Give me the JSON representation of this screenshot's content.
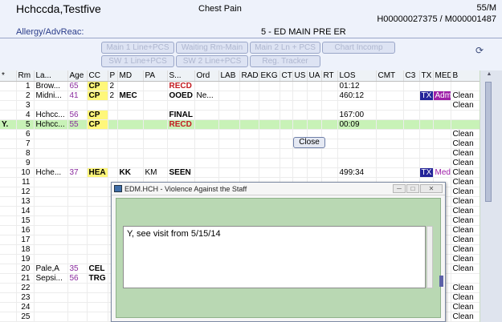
{
  "header": {
    "patient_name": "Hchccda,Testfive",
    "chief_complaint": "Chest Pain",
    "age_sex": "55/M",
    "ids": "H00000027375 / M000001487",
    "allergy_label": "Allergy/AdvReac:",
    "location": "5 - ED MAIN   PRE ER"
  },
  "toolbar": {
    "buttons": [
      "Main 1 Line+PCS",
      "Waiting Rm-Main",
      "Main 2 Ln + PCS",
      "Chart Incomp",
      "SW 1 Line+PCS",
      "SW 2 Line+PCS",
      "Reg. Tracker"
    ]
  },
  "grid": {
    "columns": [
      "*",
      "Rm",
      "La...",
      "Age",
      "CC",
      "P",
      "MD",
      "PA",
      "S...",
      "Ord",
      "LAB",
      "RAD",
      "EKG",
      "CT",
      "US",
      "UA",
      "RT",
      "LOS",
      "CMT",
      "C3",
      "TX",
      "MED",
      "B"
    ],
    "rows": [
      {
        "star": "",
        "rm": "1",
        "last": "Brow...",
        "age": "65",
        "cc": "CP",
        "p": "2",
        "md": "",
        "pa": "",
        "status": "RECD",
        "ord": "",
        "los": "01:12",
        "tx": "",
        "med": "",
        "b": ""
      },
      {
        "star": "",
        "rm": "2",
        "last": "Midni...",
        "age": "41",
        "cc": "CP",
        "p": "2",
        "md": "MEC",
        "pa": "",
        "status": "OOED",
        "ord": "Ne...",
        "los": "460:12",
        "tx": "TX",
        "med": "Adm",
        "b": "Clean"
      },
      {
        "star": "",
        "rm": "3",
        "last": "",
        "age": "",
        "cc": "",
        "p": "",
        "md": "",
        "pa": "",
        "status": "",
        "ord": "",
        "los": "",
        "tx": "",
        "med": "",
        "b": "Clean"
      },
      {
        "star": "",
        "rm": "4",
        "last": "Hchcc...",
        "age": "56",
        "cc": "CP",
        "p": "",
        "md": "",
        "pa": "",
        "status": "FINAL",
        "ord": "",
        "los": "167:00",
        "tx": "",
        "med": "",
        "b": ""
      },
      {
        "star": "Y.",
        "rm": "5",
        "last": "Hchcc...",
        "age": "55",
        "cc": "CP",
        "p": "",
        "md": "",
        "pa": "",
        "status": "RECD",
        "ord": "",
        "los": "00:09",
        "tx": "",
        "med": "",
        "b": ""
      },
      {
        "star": "",
        "rm": "6",
        "last": "",
        "age": "",
        "cc": "",
        "p": "",
        "md": "",
        "pa": "",
        "status": "",
        "ord": "",
        "los": "",
        "tx": "",
        "med": "",
        "b": "Clean"
      },
      {
        "star": "",
        "rm": "7",
        "last": "",
        "age": "",
        "cc": "",
        "p": "",
        "md": "",
        "pa": "",
        "status": "",
        "ord": "",
        "los": "",
        "tx": "",
        "med": "",
        "b": "Clean"
      },
      {
        "star": "",
        "rm": "8",
        "last": "",
        "age": "",
        "cc": "",
        "p": "",
        "md": "",
        "pa": "",
        "status": "",
        "ord": "",
        "los": "",
        "tx": "",
        "med": "",
        "b": "Clean"
      },
      {
        "star": "",
        "rm": "9",
        "last": "",
        "age": "",
        "cc": "",
        "p": "",
        "md": "",
        "pa": "",
        "status": "",
        "ord": "",
        "los": "",
        "tx": "",
        "med": "",
        "b": "Clean"
      },
      {
        "star": "",
        "rm": "10",
        "last": "Hche...",
        "age": "37",
        "cc": "HEA",
        "p": "",
        "md": "KK",
        "pa": "KM",
        "status": "SEEN",
        "ord": "",
        "los": "499:34",
        "tx": "TX",
        "med": "Med",
        "b": "Clean"
      },
      {
        "star": "",
        "rm": "11",
        "last": "",
        "age": "",
        "cc": "",
        "p": "",
        "md": "",
        "pa": "",
        "status": "",
        "ord": "",
        "los": "",
        "tx": "",
        "med": "",
        "b": "Clean"
      },
      {
        "star": "",
        "rm": "12",
        "last": "",
        "age": "",
        "cc": "",
        "p": "",
        "md": "",
        "pa": "",
        "status": "",
        "ord": "",
        "los": "",
        "tx": "",
        "med": "",
        "b": "Clean"
      },
      {
        "star": "",
        "rm": "13",
        "last": "",
        "age": "",
        "cc": "",
        "p": "",
        "md": "",
        "pa": "",
        "status": "",
        "ord": "",
        "los": "",
        "tx": "",
        "med": "",
        "b": "Clean"
      },
      {
        "star": "",
        "rm": "14",
        "last": "",
        "age": "",
        "cc": "",
        "p": "",
        "md": "",
        "pa": "",
        "status": "",
        "ord": "",
        "los": "",
        "tx": "",
        "med": "",
        "b": "Clean"
      },
      {
        "star": "",
        "rm": "15",
        "last": "",
        "age": "",
        "cc": "",
        "p": "",
        "md": "",
        "pa": "",
        "status": "",
        "ord": "",
        "los": "",
        "tx": "",
        "med": "",
        "b": "Clean"
      },
      {
        "star": "",
        "rm": "16",
        "last": "",
        "age": "",
        "cc": "",
        "p": "",
        "md": "",
        "pa": "",
        "status": "",
        "ord": "",
        "los": "",
        "tx": "",
        "med": "",
        "b": "Clean"
      },
      {
        "star": "",
        "rm": "17",
        "last": "",
        "age": "",
        "cc": "",
        "p": "",
        "md": "",
        "pa": "",
        "status": "",
        "ord": "",
        "los": "",
        "tx": "",
        "med": "",
        "b": "Clean"
      },
      {
        "star": "",
        "rm": "18",
        "last": "",
        "age": "",
        "cc": "",
        "p": "",
        "md": "",
        "pa": "",
        "status": "",
        "ord": "",
        "los": "",
        "tx": "",
        "med": "",
        "b": "Clean"
      },
      {
        "star": "",
        "rm": "19",
        "last": "",
        "age": "",
        "cc": "",
        "p": "",
        "md": "",
        "pa": "",
        "status": "",
        "ord": "",
        "los": "",
        "tx": "",
        "med": "",
        "b": "Clean"
      },
      {
        "star": "",
        "rm": "20",
        "last": "Pale,A",
        "age": "35",
        "cc": "CEL",
        "p": "",
        "md": "",
        "pa": "",
        "status": "",
        "ord": "",
        "los": "",
        "tx": "",
        "med": "",
        "b": "Clean"
      },
      {
        "star": "",
        "rm": "21",
        "last": "Sepsi...",
        "age": "56",
        "cc": "TRG",
        "p": "",
        "md": "",
        "pa": "",
        "status": "",
        "ord": "",
        "los": "",
        "tx": "",
        "med": "",
        "b": ""
      },
      {
        "star": "",
        "rm": "22",
        "last": "",
        "age": "",
        "cc": "",
        "p": "",
        "md": "",
        "pa": "",
        "status": "",
        "ord": "",
        "los": "",
        "tx": "",
        "med": "",
        "b": "Clean"
      },
      {
        "star": "",
        "rm": "23",
        "last": "",
        "age": "",
        "cc": "",
        "p": "",
        "md": "",
        "pa": "",
        "status": "",
        "ord": "",
        "los": "",
        "tx": "",
        "med": "",
        "b": "Clean"
      },
      {
        "star": "",
        "rm": "24",
        "last": "",
        "age": "",
        "cc": "",
        "p": "",
        "md": "",
        "pa": "",
        "status": "",
        "ord": "",
        "los": "",
        "tx": "",
        "med": "",
        "b": "Clean"
      },
      {
        "star": "",
        "rm": "25",
        "last": "",
        "age": "",
        "cc": "",
        "p": "",
        "md": "",
        "pa": "",
        "status": "",
        "ord": "",
        "los": "",
        "tx": "",
        "med": "",
        "b": "Clean"
      }
    ]
  },
  "dialog": {
    "title": "EDM.HCH - Violence Against the Staff",
    "text": "Y, see visit from 5/15/14",
    "close_label": "Close"
  },
  "colors": {
    "header_bg": "#eef2fb",
    "selected_row": "#c8f2b7",
    "cc_highlight": "#fff77a",
    "status_red": "#c2191e",
    "tx_blue": "#24249a",
    "med_purple": "#9e1fa8",
    "dialog_green": "#b9d8b3"
  }
}
